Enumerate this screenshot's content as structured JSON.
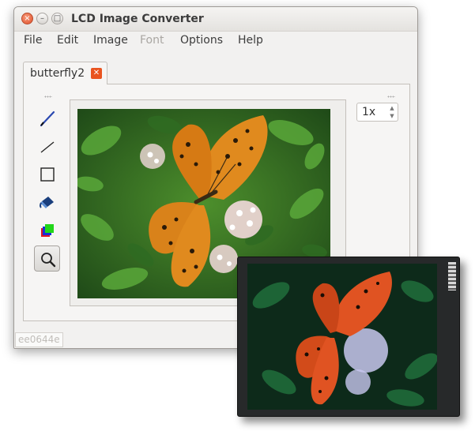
{
  "window": {
    "title": "LCD Image Converter",
    "buttons": {
      "close": "×",
      "minimize": "–",
      "maximize": "□"
    }
  },
  "menu": {
    "items": [
      {
        "label": "File",
        "enabled": true
      },
      {
        "label": "Edit",
        "enabled": true
      },
      {
        "label": "Image",
        "enabled": true
      },
      {
        "label": "Font",
        "enabled": false
      },
      {
        "label": "Options",
        "enabled": true
      },
      {
        "label": "Help",
        "enabled": true
      }
    ]
  },
  "tabs": [
    {
      "label": "butterfly2",
      "close_icon": "close-icon",
      "active": true
    }
  ],
  "tools": [
    {
      "name": "pencil-icon",
      "active": false
    },
    {
      "name": "line-icon",
      "active": false
    },
    {
      "name": "rectangle-icon",
      "active": false
    },
    {
      "name": "fill-bucket-icon",
      "active": false
    },
    {
      "name": "color-swap-icon",
      "active": false
    },
    {
      "name": "zoom-icon",
      "active": true
    }
  ],
  "zoom": {
    "value": "1x"
  },
  "status": {
    "color": "ee0644e"
  },
  "colors": {
    "accent": "#e95420",
    "butterfly": "#e08a1e",
    "leaves": "#3e8b2c"
  }
}
